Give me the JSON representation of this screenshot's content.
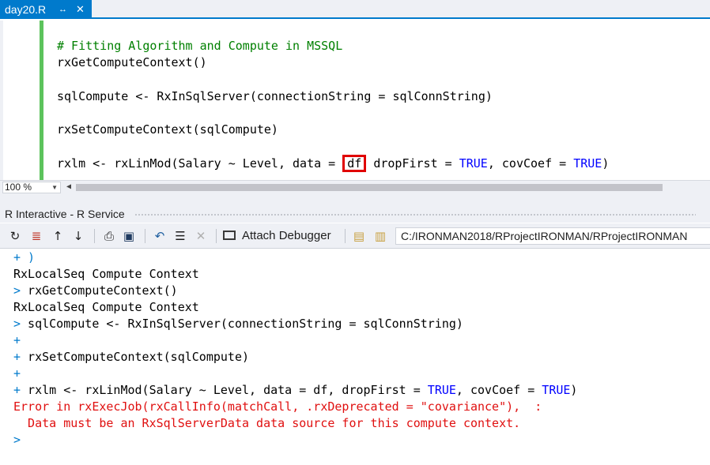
{
  "tab": {
    "title": "day20.R",
    "pin_icon": "pin-icon",
    "close_icon": "close-icon"
  },
  "editor": {
    "lines": [
      "# Fitting Algorithm and Compute in MSSQL",
      "rxGetComputeContext()",
      "sqlCompute <- RxInSqlServer(connectionString = sqlConnString)",
      "rxSetComputeContext(sqlCompute)"
    ],
    "last_line": {
      "before": "rxlm <- rxLinMod(Salary ~ Level, data = ",
      "highlight": "df",
      "middle": " dropFirst = ",
      "true1": "TRUE",
      "after": ", covCoef = ",
      "true2": "TRUE",
      "end": ")"
    },
    "highlight_color": "#e00000"
  },
  "zoom": {
    "value": "100 %"
  },
  "tool_window": {
    "title": "R Interactive - R Service",
    "attach_label": "Attach Debugger",
    "working_dir": "C:/IRONMAN2018/RProjectIRONMAN/RProjectIRONMAN",
    "icons": [
      "reset-icon",
      "clear-icon",
      "history-up-icon",
      "history-down-icon",
      "save-workspace-icon",
      "load-workspace-icon",
      "source-file-icon",
      "execute-file-icon",
      "stop-icon",
      "attach-debugger-icon",
      "folder-icon",
      "select-dir-icon"
    ]
  },
  "console": {
    "l1": "+ )",
    "l2": "RxLocalSeq Compute Context",
    "l3_prompt": ">",
    "l3": " rxGetComputeContext()",
    "l4": "RxLocalSeq Compute Context",
    "l5_prompt": ">",
    "l5": " sqlCompute <- RxInSqlServer(connectionString = sqlConnString)",
    "l6": "+",
    "l7": "+ rxSetComputeContext(sqlCompute)",
    "l8": "+",
    "l9_before": "+ rxlm <- rxLinMod(Salary ~ Level, data = df, dropFirst = ",
    "l9_true1": "TRUE",
    "l9_mid": ", covCoef = ",
    "l9_true2": "TRUE",
    "l9_end": ")",
    "err1": "Error in rxExecJob(rxCallInfo(matchCall, .rxDeprecated = \"covariance\"),  :",
    "err2": "  Data must be an RxSqlServerData data source for this compute context.",
    "final_prompt": ">"
  },
  "colors": {
    "accent": "#007acc",
    "comment": "#008000",
    "keyword": "#0000ff",
    "error": "#e01010",
    "change_bar": "#5cc35c"
  }
}
